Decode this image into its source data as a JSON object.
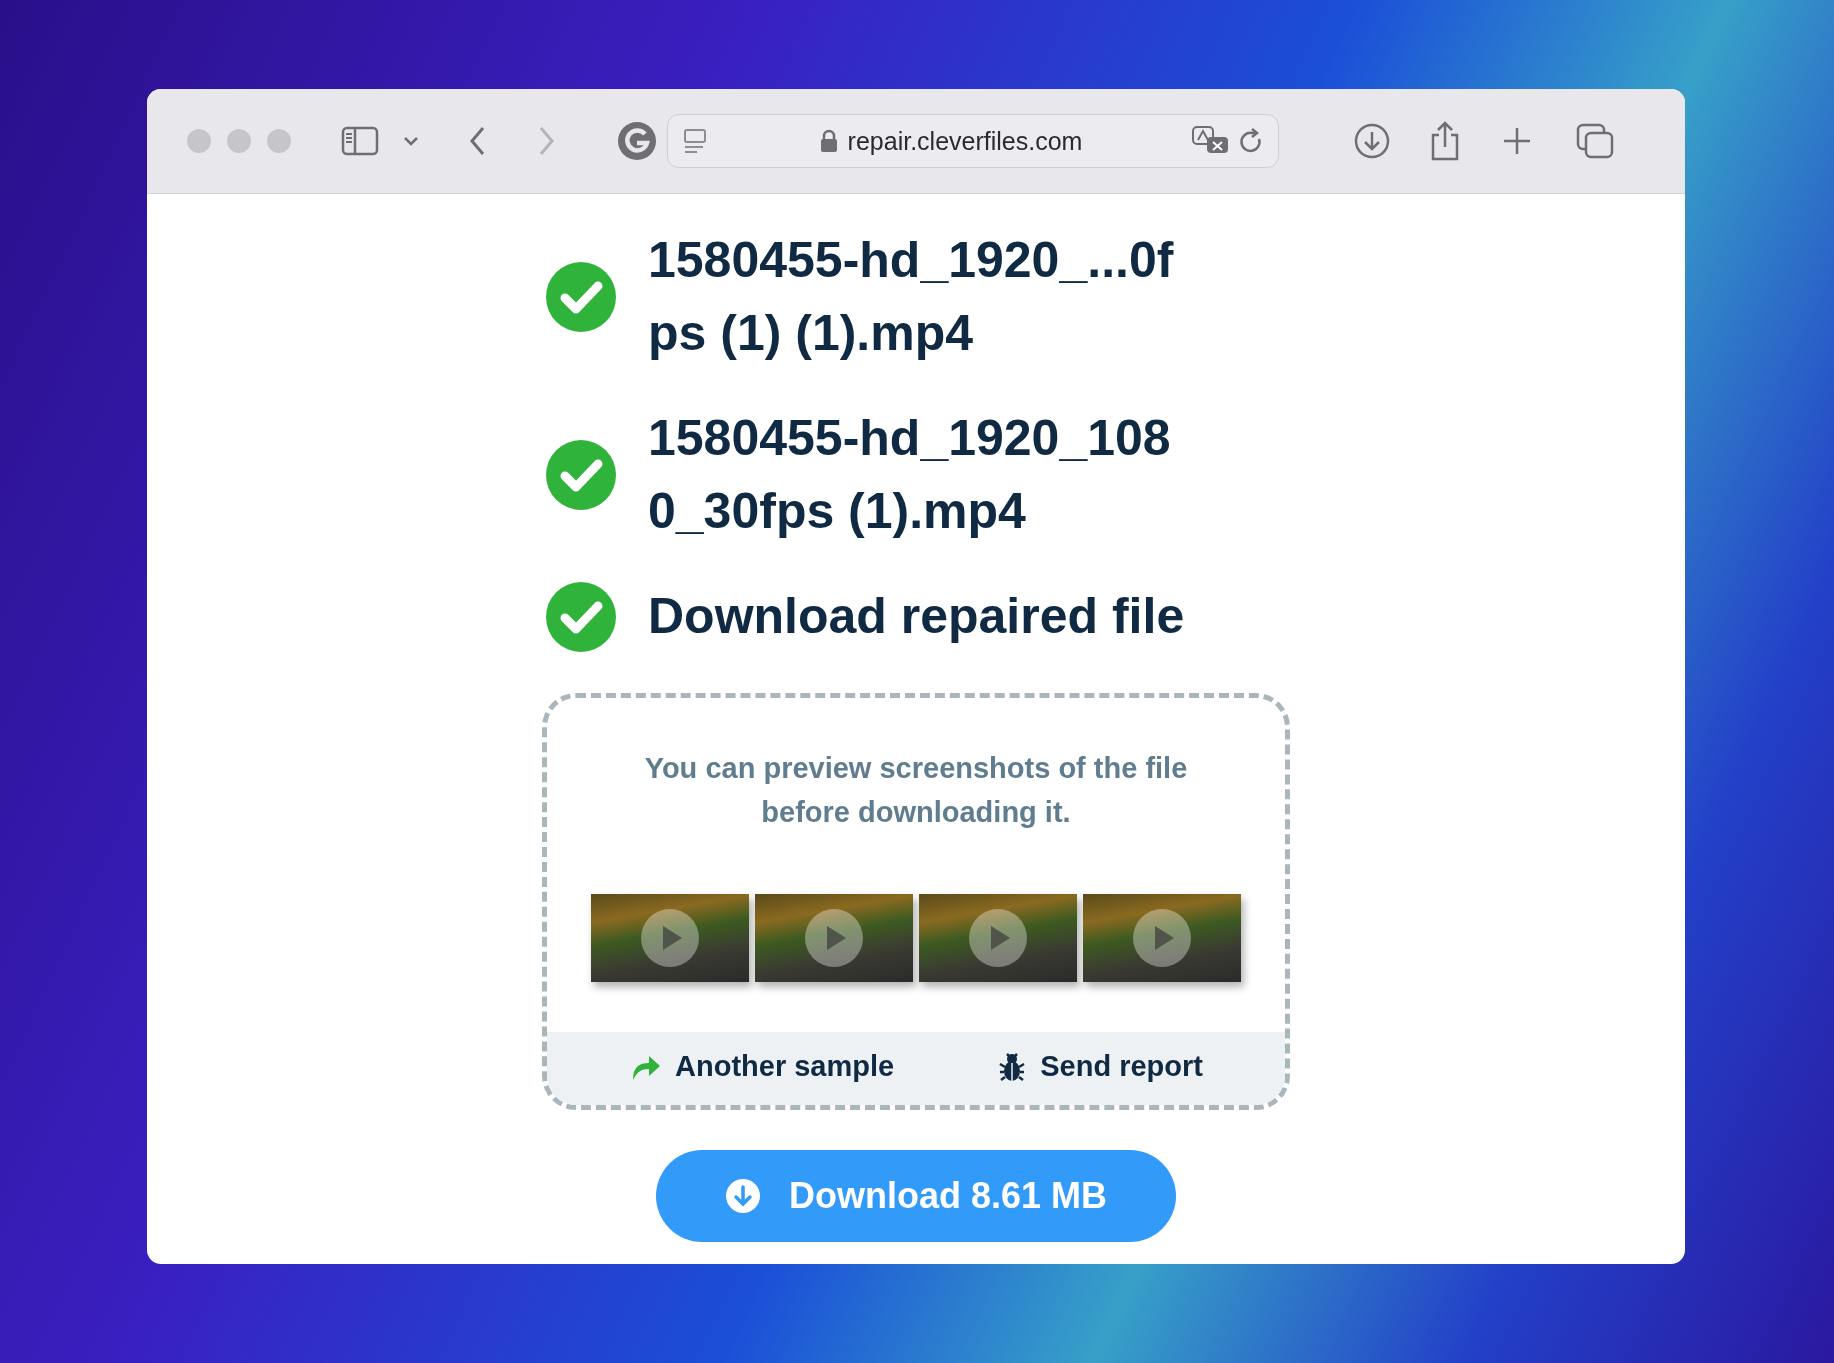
{
  "browser": {
    "url": "repair.cleverfiles.com"
  },
  "steps": [
    {
      "label": "1580455-hd_1920_...0fps (1) (1).mp4",
      "done": true
    },
    {
      "label": "1580455-hd_1920_1080_30fps (1).mp4",
      "done": true
    },
    {
      "label": "Download repaired file",
      "done": true
    }
  ],
  "preview": {
    "message": "You can preview screenshots of the file before downloading it.",
    "actions": [
      {
        "kind": "retry",
        "label": "Another sample"
      },
      {
        "kind": "report",
        "label": "Send report"
      }
    ]
  },
  "download_button": {
    "label": "Download 8.61 MB"
  }
}
